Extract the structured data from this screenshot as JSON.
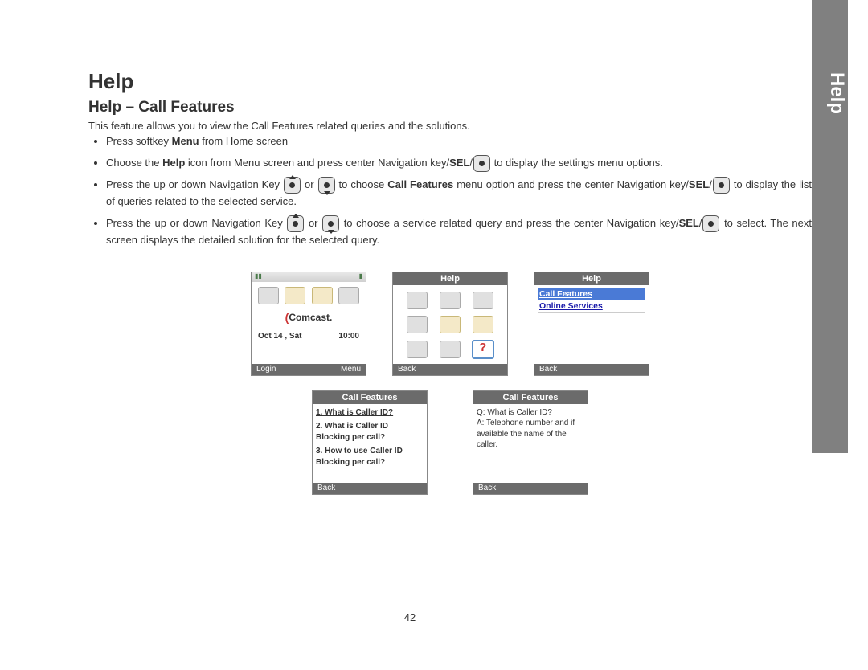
{
  "sidebar_label": "Help",
  "title": "Help",
  "section": "Help – Call Features",
  "intro": "This feature allows you to view the Call Features related queries and the solutions.",
  "bullets": {
    "b1_pre": "Press softkey ",
    "b1_bold": "Menu",
    "b1_post": " from Home screen",
    "b2_pre": "Choose the ",
    "b2_bold1": "Help",
    "b2_mid": " icon from Menu screen and press center Navigation key/",
    "b2_bold2": "SEL",
    "b2_post": " to display the settings menu options.",
    "b3_pre": "Press the up or down Navigation Key ",
    "b3_or": " or ",
    "b3_mid": " to choose ",
    "b3_bold1": "Call Features",
    "b3_mid2": " menu option and press the center Navigation key/",
    "b3_bold2": "SEL",
    "b3_post": " to display the list of queries related to the selected service.",
    "b4_pre": "Press the up or down Navigation Key ",
    "b4_or": " or ",
    "b4_mid": " to choose a service related query and press the center Navigation key/",
    "b4_bold": "SEL",
    "b4_post": " to select. The next screen displays the detailed solution for the selected query."
  },
  "screens": {
    "home": {
      "brand": "Comcast.",
      "date": "Oct 14 , Sat",
      "time": "10:00",
      "left_soft": "Login",
      "right_soft": "Menu"
    },
    "menu": {
      "title": "Help",
      "back": "Back"
    },
    "help_list": {
      "title": "Help",
      "item1": "Call Features",
      "item2": "Online Services",
      "back": "Back"
    },
    "cf_list": {
      "title": "Call Features",
      "q1": "1. What is Caller ID?",
      "q2": "2. What is Caller ID Blocking per call?",
      "q3": "3. How to use Caller ID Blocking per call?",
      "back": "Back"
    },
    "cf_detail": {
      "title": "Call Features",
      "line1": "Q: What is Caller ID?",
      "line2": "A: Telephone number and if available the name of the caller.",
      "back": "Back"
    }
  },
  "page_number": "42"
}
